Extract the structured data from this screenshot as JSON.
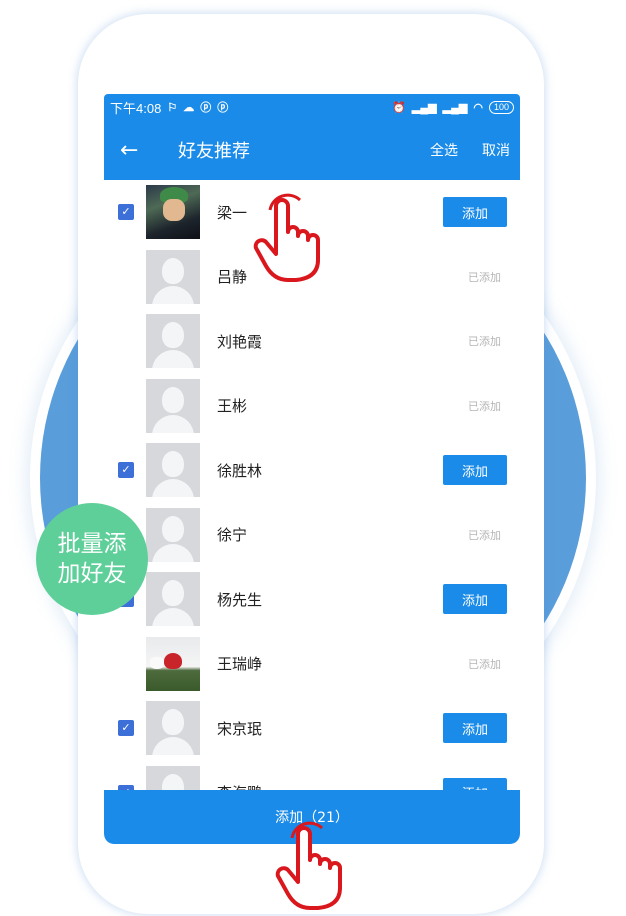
{
  "status_bar": {
    "time": "下午4:08",
    "left_icons": [
      "notification-icon",
      "cloud-icon",
      "p-icon",
      "p-icon"
    ],
    "right_icons": [
      "alarm-icon",
      "signal-icon",
      "signal-icon",
      "wifi-icon"
    ],
    "battery": "100"
  },
  "app_bar": {
    "title": "好友推荐",
    "select_all": "全选",
    "cancel": "取消"
  },
  "contacts": [
    {
      "name": "梁一",
      "checked": true,
      "state": "添加"
    },
    {
      "name": "吕静",
      "checked": false,
      "state": "已添加"
    },
    {
      "name": "刘艳霞",
      "checked": false,
      "state": "已添加"
    },
    {
      "name": "王彬",
      "checked": false,
      "state": "已添加"
    },
    {
      "name": "徐胜林",
      "checked": true,
      "state": "添加"
    },
    {
      "name": "徐宁",
      "checked": false,
      "state": "已添加"
    },
    {
      "name": "杨先生",
      "checked": true,
      "state": "添加"
    },
    {
      "name": "王瑞峥",
      "checked": false,
      "state": "已添加"
    },
    {
      "name": "宋京珉",
      "checked": true,
      "state": "添加"
    },
    {
      "name": "李海鹏",
      "checked": true,
      "state": "添加"
    }
  ],
  "bottom_button": "添加（21）",
  "badge": {
    "line1": "批量添",
    "line2": "加好友"
  },
  "colors": {
    "primary": "#1a8be8",
    "badge": "#5fcf9a",
    "circle": "#5a9ddb",
    "hand": "#d9171d"
  }
}
